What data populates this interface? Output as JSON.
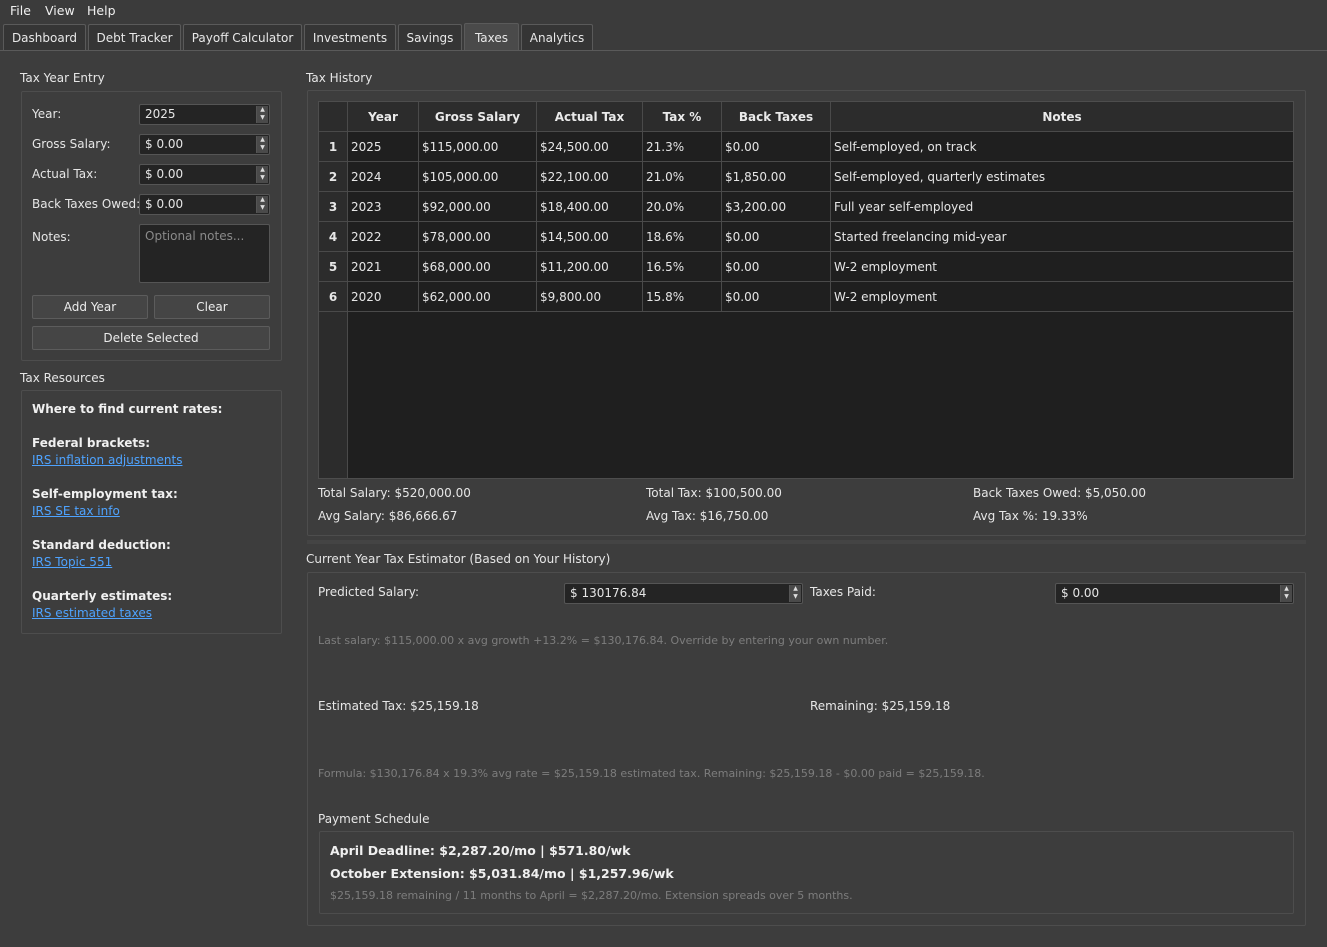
{
  "menu": {
    "items": [
      "File",
      "View",
      "Help"
    ]
  },
  "tabs": [
    {
      "label": "Dashboard"
    },
    {
      "label": "Debt Tracker"
    },
    {
      "label": "Payoff Calculator"
    },
    {
      "label": "Investments"
    },
    {
      "label": "Savings"
    },
    {
      "label": "Taxes",
      "active": true
    },
    {
      "label": "Analytics"
    }
  ],
  "entry": {
    "title": "Tax Year Entry",
    "year_label": "Year:",
    "year_value": "2025",
    "gross_label": "Gross Salary:",
    "gross_value": "$ 0.00",
    "actual_label": "Actual Tax:",
    "actual_value": "$ 0.00",
    "back_label": "Back Taxes Owed:",
    "back_value": "$ 0.00",
    "notes_label": "Notes:",
    "notes_placeholder": "Optional notes...",
    "add_button": "Add Year",
    "clear_button": "Clear",
    "delete_button": "Delete Selected"
  },
  "resources": {
    "title": "Tax Resources",
    "intro": "Where to find current rates:",
    "items": [
      {
        "heading": "Federal brackets:",
        "link": "IRS inflation adjustments"
      },
      {
        "heading": "Self-employment tax:",
        "link": "IRS SE tax info"
      },
      {
        "heading": "Standard deduction:",
        "link": "IRS Topic 551"
      },
      {
        "heading": "Quarterly estimates:",
        "link": "IRS estimated taxes"
      }
    ]
  },
  "history": {
    "title": "Tax History",
    "columns": [
      "Year",
      "Gross Salary",
      "Actual Tax",
      "Tax %",
      "Back Taxes",
      "Notes"
    ],
    "rows": [
      [
        "1",
        "2025",
        "$115,000.00",
        "$24,500.00",
        "21.3%",
        "$0.00",
        "Self-employed, on track"
      ],
      [
        "2",
        "2024",
        "$105,000.00",
        "$22,100.00",
        "21.0%",
        "$1,850.00",
        "Self-employed, quarterly estimates"
      ],
      [
        "3",
        "2023",
        "$92,000.00",
        "$18,400.00",
        "20.0%",
        "$3,200.00",
        "Full year self-employed"
      ],
      [
        "4",
        "2022",
        "$78,000.00",
        "$14,500.00",
        "18.6%",
        "$0.00",
        "Started freelancing mid-year"
      ],
      [
        "5",
        "2021",
        "$68,000.00",
        "$11,200.00",
        "16.5%",
        "$0.00",
        "W-2 employment"
      ],
      [
        "6",
        "2020",
        "$62,000.00",
        "$9,800.00",
        "15.8%",
        "$0.00",
        "W-2 employment"
      ]
    ],
    "total_salary": "Total Salary: $520,000.00",
    "avg_salary": "Avg Salary: $86,666.67",
    "total_tax": "Total Tax: $100,500.00",
    "avg_tax": "Avg Tax: $16,750.00",
    "back_owed": "Back Taxes Owed: $5,050.00",
    "avg_tax_pct": "Avg Tax %: 19.33%"
  },
  "estimator": {
    "title": "Current Year Tax Estimator (Based on Your History)",
    "predicted_label": "Predicted Salary:",
    "predicted_value": "$ 130176.84",
    "paid_label": "Taxes Paid:",
    "paid_value": "$ 0.00",
    "growth_note": "Last salary: $115,000.00 x avg growth +13.2% = $130,176.84. Override by entering your own number.",
    "estimated_tax": "Estimated Tax: $25,159.18",
    "remaining": "Remaining: $25,159.18",
    "formula": "Formula: $130,176.84 x 19.3% avg rate = $25,159.18 estimated tax. Remaining: $25,159.18 - $0.00 paid = $25,159.18."
  },
  "schedule": {
    "title": "Payment Schedule",
    "april": "April Deadline: $2,287.20/mo | $571.80/wk",
    "october": "October Extension: $5,031.84/mo | $1,257.96/wk",
    "note": "$25,159.18 remaining / 11 months to April = $2,287.20/mo. Extension spreads over 5 months."
  },
  "colors": {
    "link": "#4ea3ff",
    "background": "#3d3d3d",
    "table_bg": "#1f1f1f"
  }
}
